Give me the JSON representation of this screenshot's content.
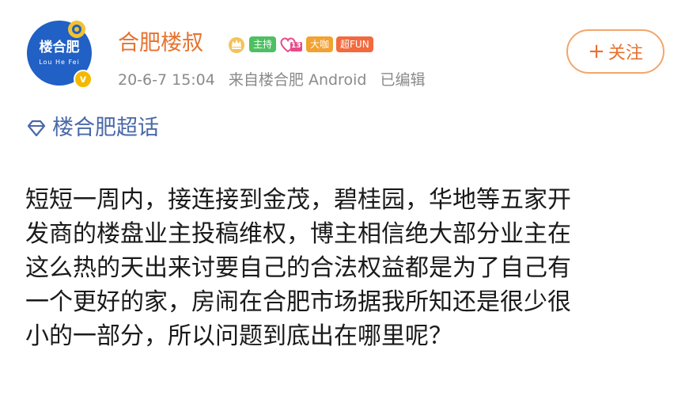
{
  "avatar": {
    "name": "楼合肥",
    "sub": "Lou He Fei",
    "badge_icon": "verified-v-icon",
    "badge_text": "v",
    "bg_color": "#2160c4",
    "badge_color": "#f5b800"
  },
  "header": {
    "username": "合肥楼叔",
    "username_color": "#e7722f",
    "badges": {
      "crown_icon": "crown-icon",
      "host_label": "主持",
      "level_label": "13",
      "fan_label": "大咖",
      "fun_label": "超FUN"
    },
    "meta": {
      "date": "20-6-7 15:04",
      "source": "来自楼合肥 Android",
      "edited": "已编辑"
    }
  },
  "follow_button": {
    "icon": "plus-icon",
    "plus": "+",
    "label": "关注"
  },
  "topic": {
    "icon": "diamond-icon",
    "label": "楼合肥超话",
    "color": "#4b68a8"
  },
  "content": {
    "lines": [
      "短短一周内，接连接到金茂，碧桂园，华地等五家开",
      "发商的楼盘业主投稿维权，博主相信绝大部分业主在",
      "这么热的天出来讨要自己的合法权益都是为了自己有",
      "一个更好的家，房闹在合肥市场据我所知还是很少很",
      "小的一部分，所以问题到底出在哪里呢？"
    ]
  }
}
